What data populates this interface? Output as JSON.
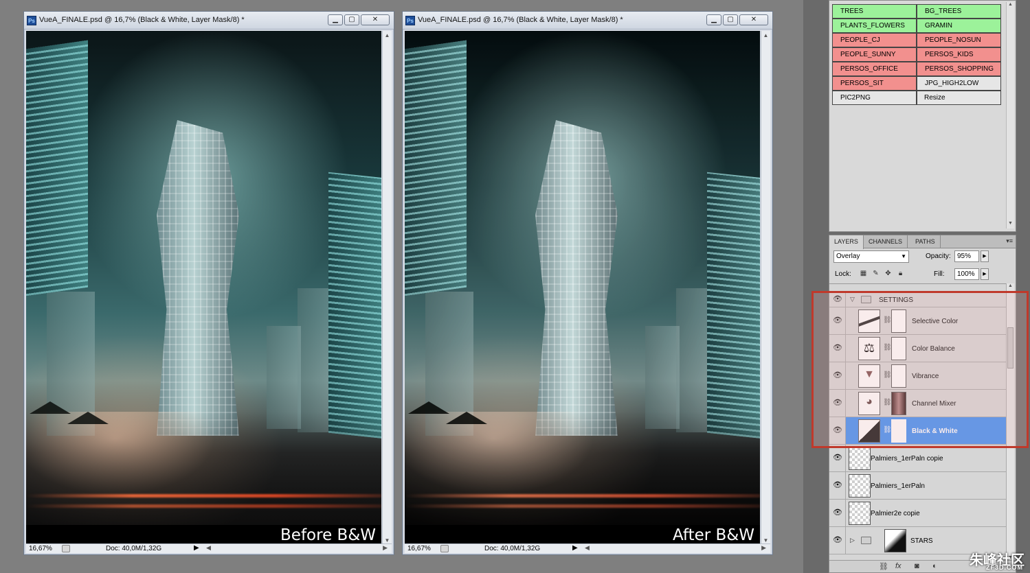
{
  "windows": [
    {
      "title": "VueA_FINALE.psd @ 16,7% (Black & White, Layer Mask/8) *",
      "caption": "Before B&W",
      "status_zoom": "16,67%",
      "status_doc": "Doc: 40,0M/1,32G"
    },
    {
      "title": "VueA_FINALE.psd @ 16,7% (Black & White, Layer Mask/8) *",
      "caption": "After B&W",
      "status_zoom": "16,67%",
      "status_doc": "Doc: 40,0M/1,32G"
    }
  ],
  "actions": [
    {
      "label": "TREES",
      "color": "green"
    },
    {
      "label": "BG_TREES",
      "color": "green"
    },
    {
      "label": "PLANTS_FLOWERS",
      "color": "green"
    },
    {
      "label": "GRAMIN",
      "color": "green"
    },
    {
      "label": "PEOPLE_CJ",
      "color": "red"
    },
    {
      "label": "PEOPLE_NOSUN",
      "color": "red"
    },
    {
      "label": "PEOPLE_SUNNY",
      "color": "red"
    },
    {
      "label": "PERSOS_KIDS",
      "color": "red"
    },
    {
      "label": "PERSOS_OFFICE",
      "color": "red"
    },
    {
      "label": "PERSOS_SHOPPING",
      "color": "red"
    },
    {
      "label": "PERSOS_SIT",
      "color": "red"
    },
    {
      "label": "JPG_HIGH2LOW",
      "color": "none"
    },
    {
      "label": "PIC2PNG",
      "color": "none"
    },
    {
      "label": "Resize",
      "color": "none"
    }
  ],
  "layers_panel": {
    "tabs": [
      "LAYERS",
      "CHANNELS",
      "PATHS"
    ],
    "blend_mode": "Overlay",
    "opacity_label": "Opacity:",
    "opacity": "95%",
    "lock_label": "Lock:",
    "fill_label": "Fill:",
    "fill": "100%",
    "group_name": "SETTINGS",
    "layers": [
      {
        "name": "Selective Color",
        "icon": "selective-color-icon"
      },
      {
        "name": "Color Balance",
        "icon": "color-balance-icon"
      },
      {
        "name": "Vibrance",
        "icon": "vibrance-icon"
      },
      {
        "name": "Channel Mixer",
        "icon": "channel-mixer-icon"
      },
      {
        "name": "Black & White",
        "icon": "black-white-icon",
        "selected": true
      },
      {
        "name": "Palmiers_1erPaln copie"
      },
      {
        "name": "Palmiers_1erPaln"
      },
      {
        "name": "Palmier2e copie"
      },
      {
        "name": "STARS"
      }
    ]
  },
  "watermark": {
    "text": "朱峰社区",
    "sub": "ZF3D.COM"
  },
  "colors": {
    "action_green": "#9cf29a",
    "action_red": "#f2908e",
    "selection_blue": "#3d8ef5",
    "highlight_red": "#c0392b"
  }
}
